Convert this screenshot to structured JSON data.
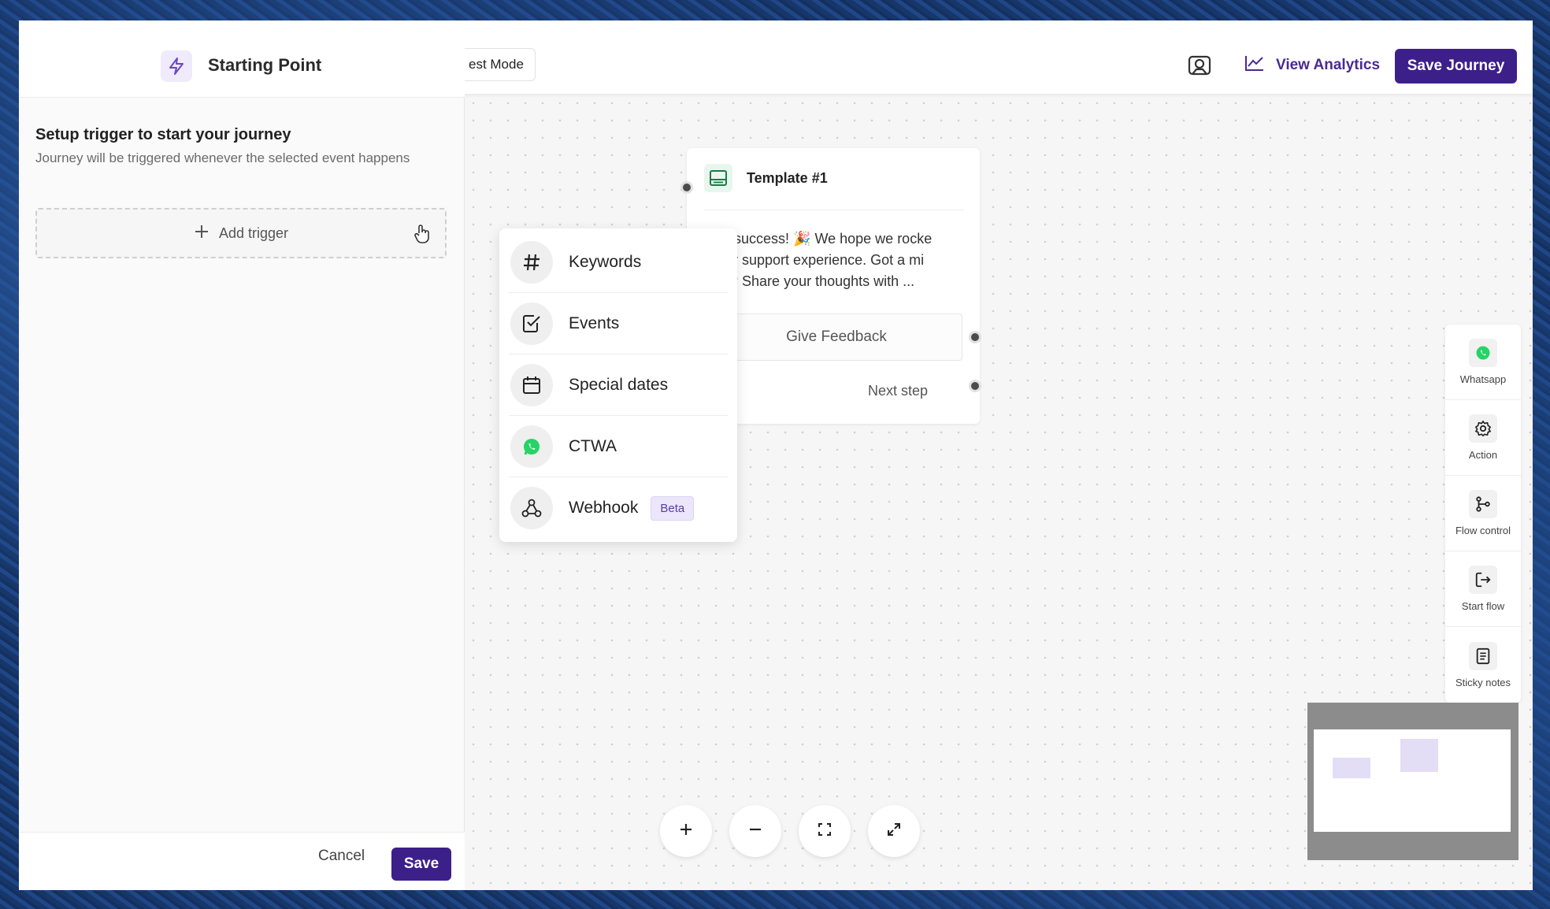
{
  "toolbar": {
    "test_mode_label": "est Mode",
    "view_analytics_label": "View Analytics",
    "save_journey_label": "Save Journey"
  },
  "sidebar": {
    "title": "Starting Point",
    "setup_title": "Setup trigger to start your journey",
    "setup_description": "Journey will be triggered whenever the selected event happens",
    "add_trigger_label": "Add trigger",
    "cancel_label": "Cancel",
    "save_label": "Save"
  },
  "trigger_menu": {
    "items": [
      {
        "label": "Keywords",
        "icon": "hash-icon"
      },
      {
        "label": "Events",
        "icon": "checkbox-icon"
      },
      {
        "label": "Special dates",
        "icon": "calendar-icon"
      },
      {
        "label": "CTWA",
        "icon": "whatsapp-icon"
      },
      {
        "label": "Webhook",
        "icon": "webhook-icon",
        "badge": "Beta"
      }
    ]
  },
  "template_node": {
    "title": "Template #1",
    "body": "hat success! 🎉 We hope we rocke\n your support experience. Got a mi\nute? Share your thoughts with ...",
    "button_label": "Give Feedback",
    "next_step_label": "Next step"
  },
  "palette": {
    "items": [
      {
        "label": "Whatsapp",
        "icon": "whatsapp-icon"
      },
      {
        "label": "Action",
        "icon": "gear-icon"
      },
      {
        "label": "Flow control",
        "icon": "branch-icon"
      },
      {
        "label": "Start flow",
        "icon": "exit-icon"
      },
      {
        "label": "Sticky notes",
        "icon": "note-icon"
      }
    ]
  },
  "colors": {
    "brand": "#3d1f8a",
    "whatsapp": "#25d366"
  }
}
